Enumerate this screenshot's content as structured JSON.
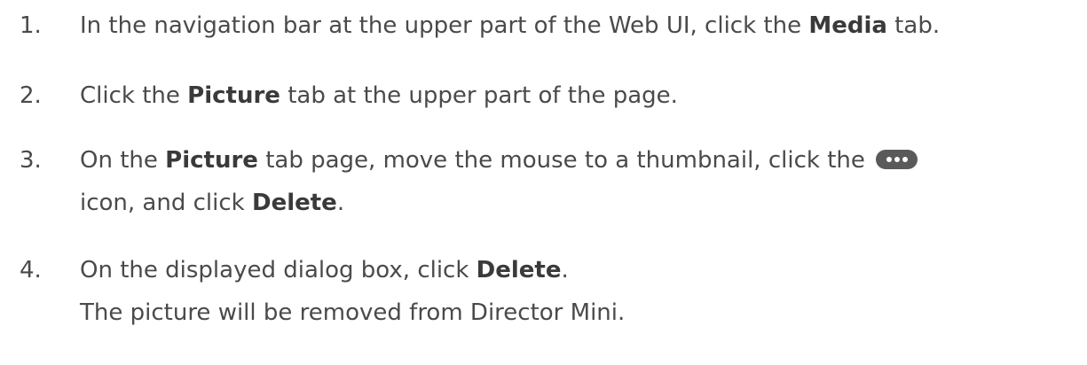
{
  "steps": [
    {
      "num": "1.",
      "pre": "In the navigation bar at the upper part of the Web UI, click the ",
      "bold": "Media",
      "post": " tab."
    },
    {
      "num": "2.",
      "pre": "Click the ",
      "bold": "Picture",
      "post": " tab at the upper part of the page."
    },
    {
      "num": "3.",
      "pre": "On the ",
      "bold": "Picture",
      "mid": " tab page, move the mouse to a thumbnail, click the ",
      "icon": "more-icon",
      "line2_pre": "icon, and click ",
      "line2_bold": "Delete",
      "line2_post": "."
    },
    {
      "num": "4.",
      "pre": "On the displayed dialog box, click ",
      "bold": "Delete",
      "post": ".",
      "result": "The picture will be removed from Director Mini."
    }
  ]
}
